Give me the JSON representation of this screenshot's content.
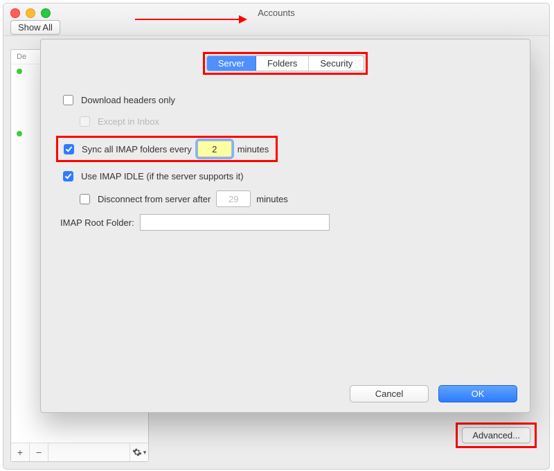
{
  "window": {
    "title": "Accounts",
    "show_all": "Show All",
    "sidebar_header": "De",
    "advanced_label": "Advanced..."
  },
  "sheet": {
    "tabs": {
      "server": "Server",
      "folders": "Folders",
      "security": "Security"
    },
    "download_headers": "Download headers only",
    "except_inbox": "Except in Inbox",
    "sync_prefix": "Sync all IMAP folders every",
    "sync_value": "2",
    "sync_unit": "minutes",
    "idle": "Use IMAP IDLE (if the server supports it)",
    "disconnect_prefix": "Disconnect from server after",
    "disconnect_value": "29",
    "disconnect_unit": "minutes",
    "root_label": "IMAP Root Folder:",
    "root_value": "",
    "cancel": "Cancel",
    "ok": "OK"
  }
}
